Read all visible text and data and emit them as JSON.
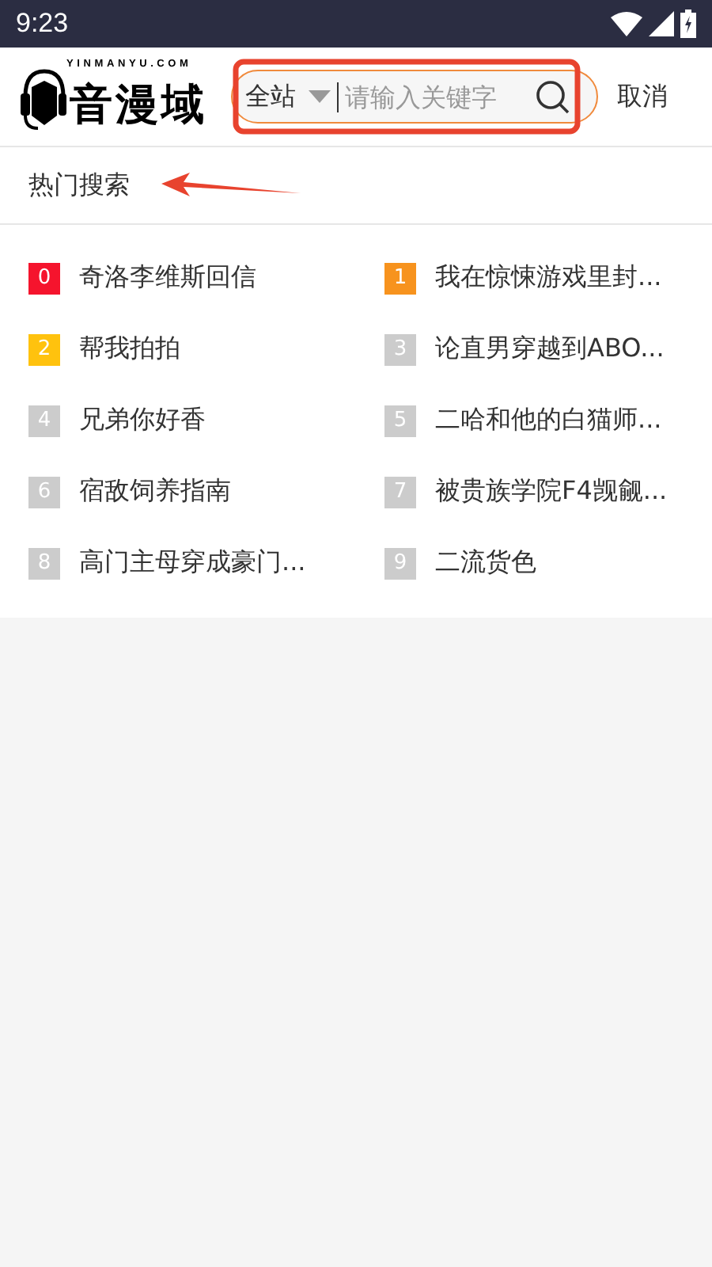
{
  "status_bar": {
    "time": "9:23"
  },
  "header": {
    "logo": {
      "domain": "YINMANYU.COM",
      "name": "音漫域"
    },
    "search": {
      "scope": "全站",
      "placeholder": "请输入关键字"
    },
    "cancel": "取消"
  },
  "hot_search": {
    "title": "热门搜索",
    "items": [
      {
        "rank": "0",
        "title": "奇洛李维斯回信",
        "color": "#f5142d"
      },
      {
        "rank": "1",
        "title": "我在惊悚游戏里封...",
        "color": "#f7931e"
      },
      {
        "rank": "2",
        "title": "帮我拍拍",
        "color": "#ffc20e"
      },
      {
        "rank": "3",
        "title": "论直男穿越到ABO...",
        "color": "#cccccc"
      },
      {
        "rank": "4",
        "title": "兄弟你好香",
        "color": "#cccccc"
      },
      {
        "rank": "5",
        "title": "二哈和他的白猫师...",
        "color": "#cccccc"
      },
      {
        "rank": "6",
        "title": "宿敌饲养指南",
        "color": "#cccccc"
      },
      {
        "rank": "7",
        "title": "被贵族学院F4觊觎...",
        "color": "#cccccc"
      },
      {
        "rank": "8",
        "title": "高门主母穿成豪门...",
        "color": "#cccccc"
      },
      {
        "rank": "9",
        "title": "二流货色",
        "color": "#cccccc"
      }
    ]
  }
}
